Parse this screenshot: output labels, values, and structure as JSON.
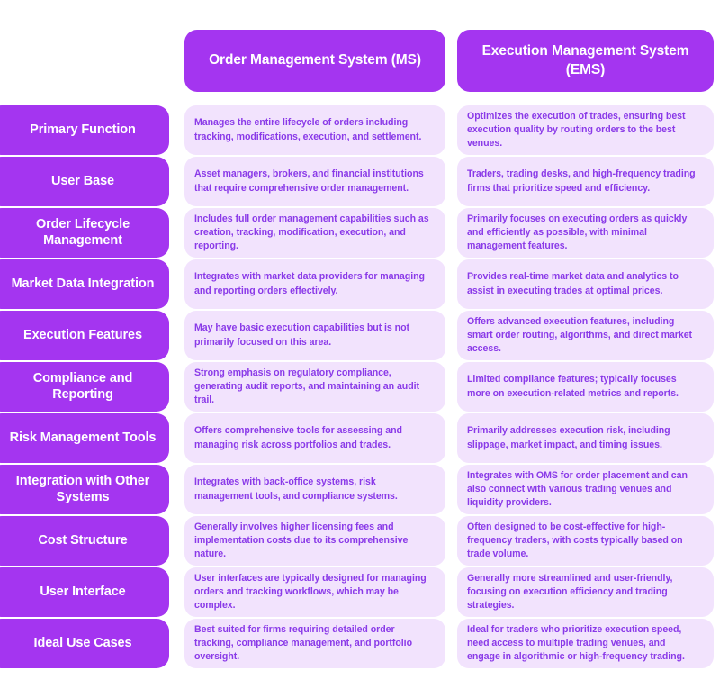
{
  "theme": {
    "page_background": "#ffffff",
    "accent_purple": "#a435f0",
    "cell_background": "#f2e3fd",
    "body_text_color": "#8a3ae8",
    "header_text_color": "#ffffff"
  },
  "header": {
    "column_a": "Order Management System (MS)",
    "column_b": "Execution Management System (EMS)"
  },
  "rows": [
    {
      "label": "Primary Function",
      "oms": "Manages the entire lifecycle of orders including tracking, modifications, execution, and settlement.",
      "ems": "Optimizes the execution of trades, ensuring best execution quality by routing orders to the best venues."
    },
    {
      "label": "User Base",
      "oms": "Asset managers, brokers, and financial institutions that require comprehensive order management.",
      "ems": "Traders, trading desks, and high-frequency trading firms that prioritize speed and efficiency."
    },
    {
      "label": "Order Lifecycle Management",
      "oms": "Includes full order management capabilities such as creation, tracking, modification, execution, and reporting.",
      "ems": "Primarily focuses on executing orders as quickly and efficiently as possible, with minimal management features."
    },
    {
      "label": "Market Data Integration",
      "oms": "Integrates with market data providers for managing and reporting orders effectively.",
      "ems": "Provides real-time market data and analytics to assist in executing trades at optimal prices."
    },
    {
      "label": "Execution Features",
      "oms": "May have basic execution capabilities but is not primarily focused on this area.",
      "ems": "Offers advanced execution features, including smart order routing, algorithms, and direct market access."
    },
    {
      "label": "Compliance and Reporting",
      "oms": "Strong emphasis on regulatory compliance, generating audit reports, and maintaining an audit trail.",
      "ems": "Limited compliance features; typically focuses more on execution-related metrics and reports."
    },
    {
      "label": "Risk Management Tools",
      "oms": "Offers comprehensive tools for assessing and managing risk across portfolios and trades.",
      "ems": "Primarily addresses execution risk, including slippage, market impact, and timing issues."
    },
    {
      "label": "Integration with Other Systems",
      "oms": "Integrates with back-office systems, risk management tools, and compliance systems.",
      "ems": "Integrates with OMS for order placement and can also connect with various trading venues and liquidity providers."
    },
    {
      "label": "Cost Structure",
      "oms": "Generally involves higher licensing fees and implementation costs due to its comprehensive nature.",
      "ems": "Often designed to be cost-effective for high-frequency traders, with costs typically based on trade volume."
    },
    {
      "label": "User Interface",
      "oms": "User interfaces are typically designed for managing orders and tracking workflows, which may be complex.",
      "ems": "Generally more streamlined and user-friendly, focusing on execution efficiency and trading strategies."
    },
    {
      "label": "Ideal Use Cases",
      "oms": "Best suited for firms requiring detailed order tracking, compliance management, and portfolio oversight.",
      "ems": "Ideal for traders who prioritize execution speed, need access to multiple trading venues, and engage in algorithmic or high-frequency trading."
    }
  ]
}
